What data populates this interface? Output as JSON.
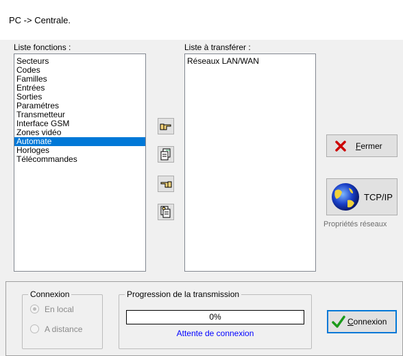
{
  "window": {
    "title": "PC -> Centrale."
  },
  "functions": {
    "label": "Liste fonctions :",
    "items": [
      "Secteurs",
      "Codes",
      "Familles",
      "Entrées",
      "Sorties",
      "Paramétres",
      "Transmetteur",
      "Interface GSM",
      "Zones vidéo",
      "Automate",
      "Horloges",
      "Télécommandes"
    ],
    "selected": "Automate"
  },
  "transfer": {
    "label": "Liste à transférer :",
    "items": [
      "Réseaux LAN/WAN"
    ]
  },
  "transfer_buttons": {
    "add_icon": "pointing-hand-right-icon",
    "add_all_icon": "multiple-documents-icon",
    "remove_icon": "pointing-hand-left-icon",
    "remove_all_icon": "documents-back-icon"
  },
  "close_button": {
    "accel": "F",
    "rest": "ermer",
    "icon": "red-x-icon"
  },
  "tcpip_button": {
    "label": "TCP/IP",
    "icon": "globe-icon",
    "caption": "Propriétés réseaux"
  },
  "connection": {
    "legend": "Connexion",
    "local": "En local",
    "remote": "A distance",
    "selected": "local"
  },
  "progress": {
    "legend": "Progression de la transmission",
    "percent_text": "0%",
    "value": 0,
    "status": "Attente de connexion"
  },
  "connect_button": {
    "accel": "C",
    "rest": "onnexion",
    "icon": "green-check-icon"
  },
  "colors": {
    "selection": "#0078d7",
    "status_text": "#0000ff",
    "close_x": "#cc0000",
    "check": "#1a9a1a"
  }
}
